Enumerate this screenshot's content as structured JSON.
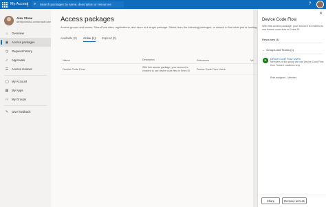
{
  "topbar": {
    "app_title": "My Access",
    "search_placeholder": "Search packages by name, description or resources",
    "help_icon": "question-icon"
  },
  "profile": {
    "name": "Alex Stone",
    "email": "alex@contoso.onmicrosoft.com"
  },
  "nav": {
    "items": [
      {
        "label": "Overview",
        "icon": "home-icon"
      },
      {
        "label": "Access packages",
        "icon": "package-icon",
        "active": true
      },
      {
        "label": "Request history",
        "icon": "history-icon"
      },
      {
        "label": "Approvals",
        "icon": "approval-icon"
      },
      {
        "label": "Access reviews",
        "icon": "review-icon"
      }
    ],
    "items2": [
      {
        "label": "My Account",
        "icon": "person-icon"
      },
      {
        "label": "My Apps",
        "icon": "apps-icon"
      },
      {
        "label": "My Groups",
        "icon": "groups-icon"
      }
    ],
    "items3": [
      {
        "label": "Give feedback",
        "icon": "feedback-icon"
      }
    ]
  },
  "main": {
    "title": "Access packages",
    "description": "Access groups and teams, SharePoint sites, applications, and more in a single package. Select from the following packages, or search to find what you're looking for.",
    "tabs": [
      {
        "label": "Available (0)"
      },
      {
        "label": "Active (1)",
        "active": true
      },
      {
        "label": "Expired (0)"
      }
    ],
    "columns": [
      "Name",
      "Description",
      "Resources",
      "Ve"
    ],
    "rows": [
      {
        "name": "Device Code Flow",
        "description": "With this access package, your account is enabled to use device code flow in Entra ID",
        "resources": "Device Code Flow Users"
      }
    ]
  },
  "panel": {
    "title": "Device Code Flow",
    "description": "With this access package, your account is enabled to use device code flow in Entra ID.",
    "tab": "Resources (1)",
    "group_heading": "Groups and Teams (1)",
    "resource": {
      "name": "Device Code Flow Users",
      "description": "Members of this group can use Device Code Flow from Trusted Locations only",
      "role": "Role assigned - Member"
    },
    "share_label": "Share",
    "remove_label": "Remove access"
  },
  "colors": {
    "topbar": "#0f6cbd",
    "accent": "#0f6cbd",
    "group_icon": "#107c10"
  }
}
